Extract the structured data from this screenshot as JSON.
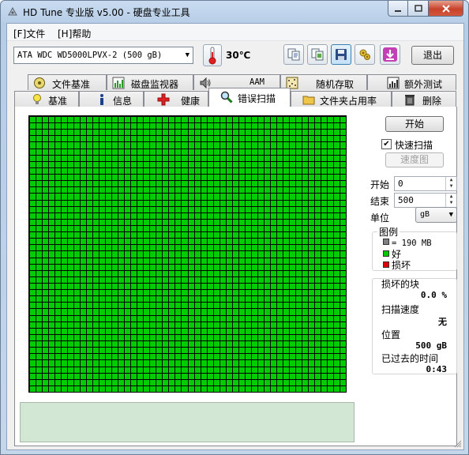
{
  "window": {
    "title": "HD Tune 专业版 v5.00 - 硬盘专业工具"
  },
  "menu": {
    "file": "[F]文件",
    "help": "[H]帮助"
  },
  "toolbar": {
    "drive": "ATA    WDC WD5000LPVX-2 (500 gB)",
    "temperature": "30℃",
    "exit_label": "退出",
    "icons": [
      "copy-icon",
      "copy-screenshot-icon",
      "save-icon",
      "options-icon",
      "download-icon"
    ]
  },
  "tabs": {
    "row1": [
      "文件基准",
      "磁盘监视器",
      "AAM",
      "随机存取",
      "额外测试"
    ],
    "row2": [
      "基准",
      "信息",
      "健康",
      "错误扫描",
      "文件夹占用率",
      "删除"
    ],
    "selected": "错误扫描"
  },
  "scan": {
    "start_button": "开始",
    "quick_scan_label": "快速扫描",
    "quick_scan_checked": true,
    "speed_map_button": "速度图",
    "start_label": "开始",
    "start_value": "0",
    "end_label": "结束",
    "end_value": "500",
    "unit_label": "单位",
    "unit_value": "gB"
  },
  "legend": {
    "title": "图例",
    "block_size": "= 190 MB",
    "good": "好",
    "bad": "损坏",
    "colors": {
      "block": "#808080",
      "good": "#00c800",
      "bad": "#e00000"
    }
  },
  "stats": {
    "damaged_blocks_label": "损坏的块",
    "damaged_blocks_value": "0.0 %",
    "scan_speed_label": "扫描速度",
    "scan_speed_value": "无",
    "position_label": "位置",
    "position_value": "500 gB",
    "elapsed_label": "已过去的时间",
    "elapsed_value": "0:43"
  },
  "grid": {
    "fill_color": "#00cc00",
    "line_color": "#000000"
  }
}
